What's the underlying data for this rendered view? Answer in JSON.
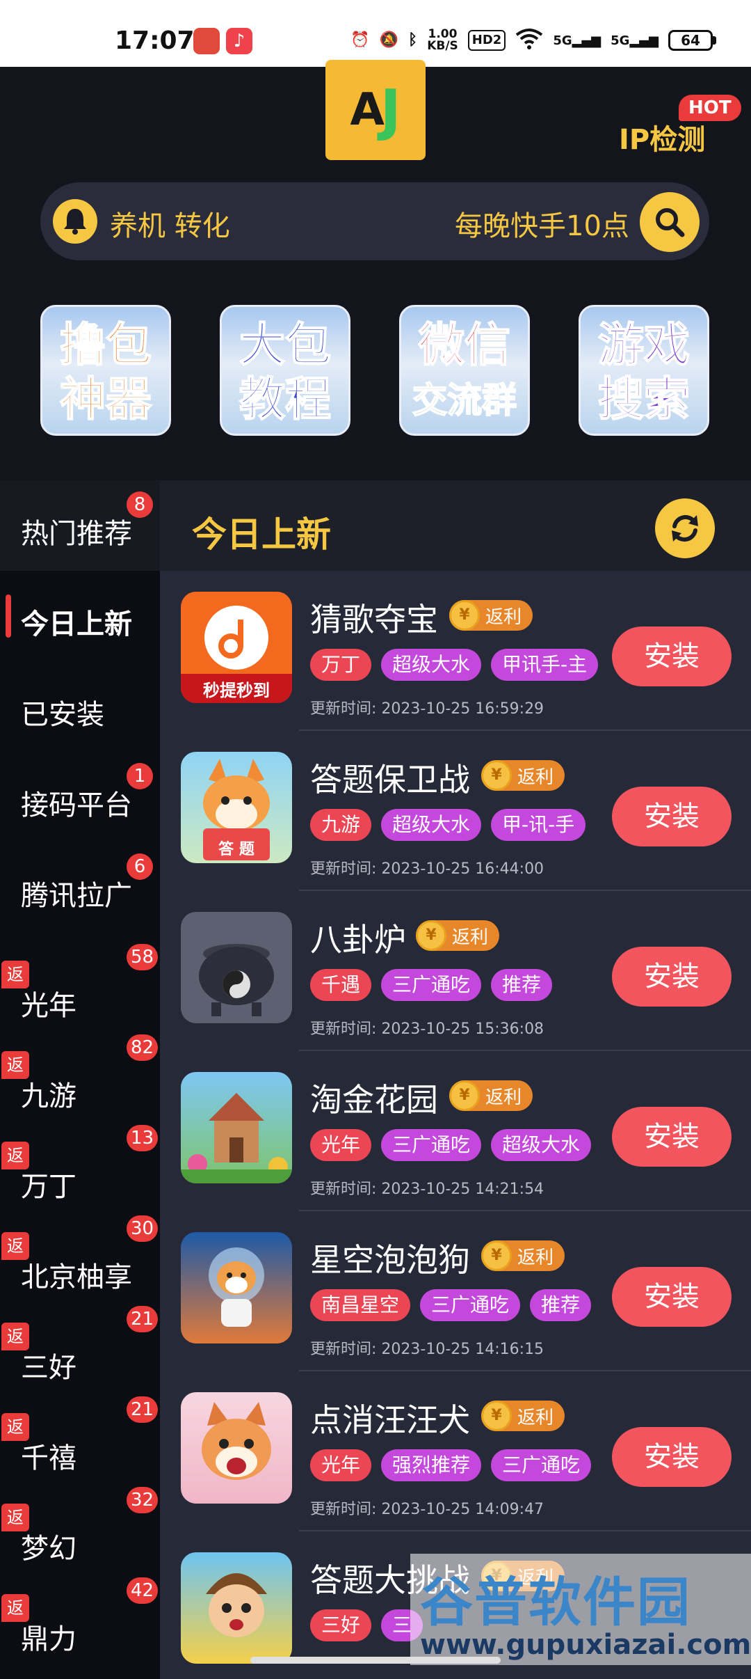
{
  "status_bar": {
    "time": "17:07",
    "speed_top": "1.00",
    "speed_unit": "KB/S",
    "hd_label": "HD2",
    "net1": "5G",
    "net2": "5G",
    "battery": "64"
  },
  "header": {
    "logo_a": "A",
    "logo_j": "J",
    "ip_label": "IP检测",
    "hot_badge": "HOT"
  },
  "notice": {
    "left_text": "养机 转化",
    "right_text": "每晚快手10点"
  },
  "features": [
    {
      "line1": "撸包",
      "line2": "神器"
    },
    {
      "line1": "大包",
      "line2": "教程"
    },
    {
      "line1": "微信",
      "line2": "交流群"
    },
    {
      "line1": "游戏",
      "line2": "搜索"
    }
  ],
  "sidebar": {
    "rebate_mark": "返",
    "items": [
      {
        "label": "热门推荐",
        "badge": "8"
      },
      {
        "label": "今日上新",
        "badge": ""
      },
      {
        "label": "已安装",
        "badge": ""
      },
      {
        "label": "接码平台",
        "badge": "1"
      },
      {
        "label": "腾讯拉广",
        "badge": "6"
      },
      {
        "label": "光年",
        "badge": "58"
      },
      {
        "label": "九游",
        "badge": "82"
      },
      {
        "label": "万丁",
        "badge": "13"
      },
      {
        "label": "北京柚享",
        "badge": "30"
      },
      {
        "label": "三好",
        "badge": "21"
      },
      {
        "label": "千禧",
        "badge": "21"
      },
      {
        "label": "梦幻",
        "badge": "32"
      },
      {
        "label": "鼎力",
        "badge": "42"
      }
    ]
  },
  "content": {
    "title": "今日上新",
    "fanli_label": "返利",
    "coin_symbol": "¥",
    "install_label": "安装",
    "apps": [
      {
        "name": "猜歌夺宝",
        "tags": [
          "万丁",
          "超级大水",
          "甲讯手-主"
        ],
        "updated": "更新时间: 2023-10-25 16:59:29",
        "icon_caption": "秒提秒到"
      },
      {
        "name": "答题保卫战",
        "tags": [
          "九游",
          "超级大水",
          "甲-讯-手"
        ],
        "updated": "更新时间: 2023-10-25 16:44:00",
        "icon_caption": "答 题"
      },
      {
        "name": "八卦炉",
        "tags": [
          "千遇",
          "三广通吃",
          "推荐"
        ],
        "updated": "更新时间: 2023-10-25 15:36:08",
        "icon_caption": ""
      },
      {
        "name": "淘金花园",
        "tags": [
          "光年",
          "三广通吃",
          "超级大水"
        ],
        "updated": "更新时间: 2023-10-25 14:21:54",
        "icon_caption": ""
      },
      {
        "name": "星空泡泡狗",
        "tags": [
          "南昌星空",
          "三广通吃",
          "推荐"
        ],
        "updated": "更新时间: 2023-10-25 14:16:15",
        "icon_caption": ""
      },
      {
        "name": "点消汪汪犬",
        "tags": [
          "光年",
          "强烈推荐",
          "三广通吃"
        ],
        "updated": "更新时间: 2023-10-25 14:09:47",
        "icon_caption": ""
      },
      {
        "name": "答题大挑战",
        "tags": [
          "三好",
          "三"
        ],
        "updated": "",
        "icon_caption": ""
      }
    ]
  },
  "watermark": {
    "line1": "谷普软件园",
    "line2": "www.gupuxiazai.com"
  }
}
